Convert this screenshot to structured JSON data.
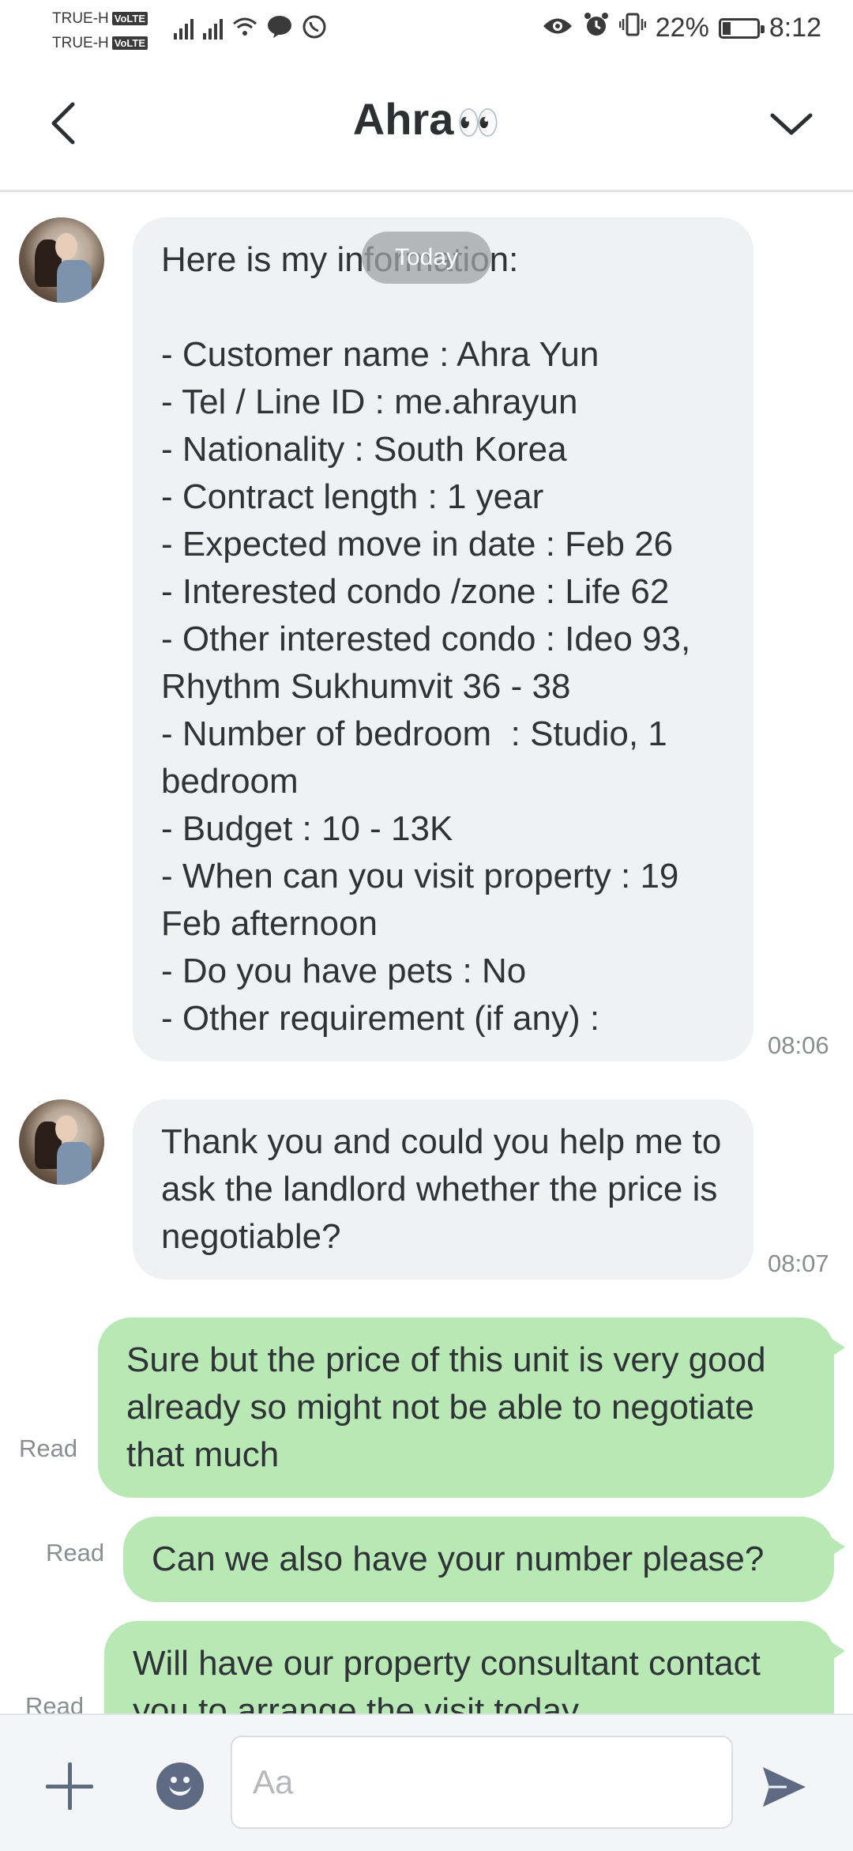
{
  "status_bar": {
    "carrier1": "TRUE-H",
    "carrier2": "TRUE-H",
    "volte": "VoLTE",
    "battery_percent": "22%",
    "battery_level": 0.22,
    "time": "8:12"
  },
  "header": {
    "title": "Ahra",
    "title_emoji": "👀"
  },
  "chat": {
    "date_label": "Today",
    "messages": [
      {
        "direction": "in",
        "text": "Here is my information:\n\n- Customer name : Ahra Yun\n- Tel / Line ID : me.ahrayun\n- Nationality : South Korea\n- Contract length : 1 year\n- Expected move in date : Feb 26\n- Interested condo /zone : Life 62\n- Other interested condo : Ideo 93, Rhythm Sukhumvit 36 - 38\n- Number of bedroom  : Studio, 1 bedroom\n- Budget : 10 - 13K\n- When can you visit property : 19 Feb afternoon\n- Do you have pets : No\n- Other requirement (if any) :",
        "time": "08:06"
      },
      {
        "direction": "in",
        "text": "Thank you and could you help me to ask the landlord whether the price is negotiable?",
        "time": "08:07"
      },
      {
        "direction": "out",
        "text": "Sure but the price of this unit is very good already so might not be able to negotiate that much",
        "status": "Read"
      },
      {
        "direction": "out",
        "text": "Can we also have your number please?",
        "status": "Read"
      },
      {
        "direction": "out",
        "text": "Will have our property consultant contact you to arrange the visit today",
        "status": "Read"
      }
    ]
  },
  "input": {
    "placeholder": "Aa"
  },
  "icons": {
    "back": "chevron-left-icon",
    "menu": "chevron-down-icon",
    "add": "plus-icon",
    "emoji": "emoji-icon",
    "send": "send-icon"
  },
  "colors": {
    "incoming_bubble": "#f0f1f3",
    "outgoing_bubble": "#b8e8b3",
    "icon": "#5d6a82"
  }
}
